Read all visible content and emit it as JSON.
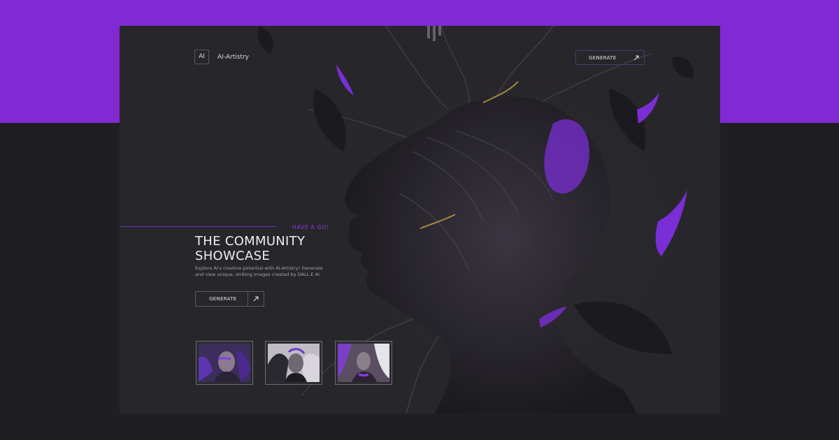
{
  "brand": {
    "badge": "AI",
    "name": "AI-Artistry"
  },
  "header": {
    "generate_label": "GENERATE"
  },
  "hero": {
    "eyebrow": "HAVE A GO!",
    "title_line1": "THE COMMUNITY",
    "title_line2": "SHOWCASE",
    "description": "Explore AI's creative potential with AI-Artistry! Generate and view unique, striking images created by DALL-E AI.",
    "cta_label": "GENERATE"
  },
  "icons": {
    "arrow": "arrow-up-right-icon"
  },
  "colors": {
    "accent": "#8129d4",
    "background": "#1f1f22",
    "panel": "#27262a"
  }
}
